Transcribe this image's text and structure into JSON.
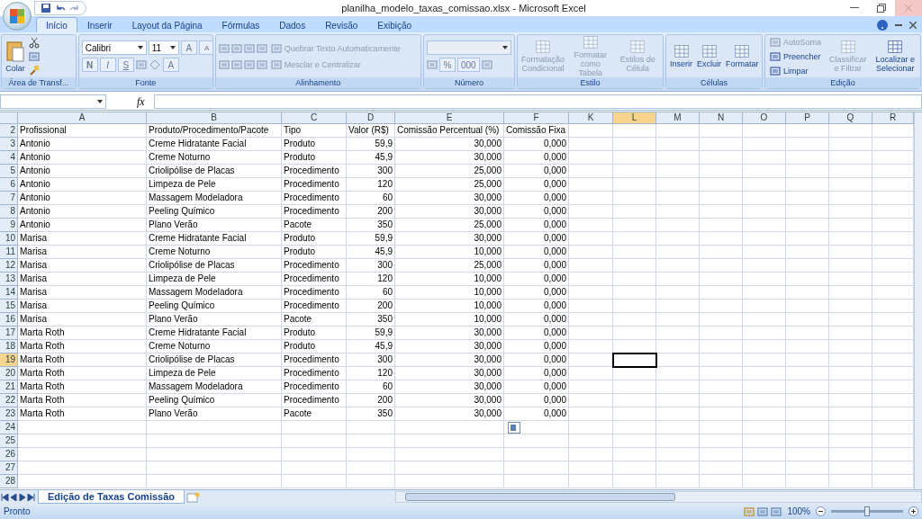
{
  "window": {
    "title": "planilha_modelo_taxas_comissao.xlsx - Microsoft Excel"
  },
  "tabs": [
    {
      "label": "Início",
      "selected": true
    },
    {
      "label": "Inserir",
      "selected": false
    },
    {
      "label": "Layout da Página",
      "selected": false
    },
    {
      "label": "Fórmulas",
      "selected": false
    },
    {
      "label": "Dados",
      "selected": false
    },
    {
      "label": "Revisão",
      "selected": false
    },
    {
      "label": "Exibição",
      "selected": false
    }
  ],
  "ribbon": {
    "clipboard": {
      "title": "Área de Transf...",
      "paste": "Colar"
    },
    "font": {
      "title": "Fonte",
      "name": "Calibri",
      "size": "11",
      "grow": "A",
      "shrink": "A",
      "bold": "N",
      "italic": "I",
      "underline": "S",
      "font_color_label": "A"
    },
    "alignment": {
      "title": "Alinhamento",
      "wrap": {
        "label": "Quebrar Texto Automaticamente",
        "disabled": true
      },
      "merge": {
        "label": "Mesclar e Centralizar",
        "disabled": true
      }
    },
    "number": {
      "title": "Número",
      "percent": "%",
      "thousands": "000"
    },
    "styles": {
      "title": "Estilo",
      "buttons": [
        {
          "label": "Formatação Condicional",
          "disabled": true
        },
        {
          "label": "Formatar como Tabela",
          "disabled": true
        },
        {
          "label": "Estilos de Célula",
          "disabled": true
        }
      ]
    },
    "cells": {
      "title": "Células",
      "buttons": [
        {
          "label": "Inserir",
          "disabled": false
        },
        {
          "label": "Excluir",
          "disabled": false
        },
        {
          "label": "Formatar",
          "disabled": false
        }
      ]
    },
    "editing": {
      "title": "Edição",
      "small": [
        {
          "label": "AutoSoma",
          "disabled": true
        },
        {
          "label": "Preencher",
          "disabled": false
        },
        {
          "label": "Limpar",
          "disabled": false
        }
      ],
      "buttons": [
        {
          "label": "Classificar e Filtrar",
          "disabled": true
        },
        {
          "label": "Localizar e Selecionar",
          "disabled": false
        }
      ]
    }
  },
  "formula_bar": {
    "function_label": "fx"
  },
  "columns": [
    {
      "label": "A",
      "kind": "text",
      "selected": false
    },
    {
      "label": "B",
      "kind": "text",
      "selected": false
    },
    {
      "label": "C",
      "kind": "text",
      "selected": false
    },
    {
      "label": "D",
      "kind": "number",
      "selected": false
    },
    {
      "label": "E",
      "kind": "number",
      "selected": false
    },
    {
      "label": "F",
      "kind": "number",
      "selected": false
    },
    {
      "label": "K",
      "kind": "text",
      "selected": false
    },
    {
      "label": "L",
      "kind": "text",
      "selected": true
    },
    {
      "label": "M",
      "kind": "text",
      "selected": false
    },
    {
      "label": "N",
      "kind": "text",
      "selected": false
    },
    {
      "label": "O",
      "kind": "text",
      "selected": false
    },
    {
      "label": "P",
      "kind": "text",
      "selected": false
    },
    {
      "label": "Q",
      "kind": "text",
      "selected": false
    },
    {
      "label": "R",
      "kind": "text",
      "selected": false
    }
  ],
  "rows": [
    {
      "number": "2",
      "selected": false,
      "cells": [
        "Profissional",
        "Produto/Procedimento/Pacote",
        "Tipo",
        "Valor (R$)",
        "Comissão Percentual (%)",
        "Comissão Fixa"
      ]
    },
    {
      "number": "3",
      "selected": false,
      "cells": [
        "Antonio",
        "Creme Hidratante Facial",
        "Produto",
        "59,9",
        "30,000",
        "0,000"
      ]
    },
    {
      "number": "4",
      "selected": false,
      "cells": [
        "Antonio",
        "Creme Noturno",
        "Produto",
        "45,9",
        "30,000",
        "0,000"
      ]
    },
    {
      "number": "5",
      "selected": false,
      "cells": [
        "Antonio",
        "Criolipólise de Placas",
        "Procedimento",
        "300",
        "25,000",
        "0,000"
      ]
    },
    {
      "number": "6",
      "selected": false,
      "cells": [
        "Antonio",
        "Limpeza de Pele",
        "Procedimento",
        "120",
        "25,000",
        "0,000"
      ]
    },
    {
      "number": "7",
      "selected": false,
      "cells": [
        "Antonio",
        "Massagem Modeladora",
        "Procedimento",
        "60",
        "30,000",
        "0,000"
      ]
    },
    {
      "number": "8",
      "selected": false,
      "cells": [
        "Antonio",
        "Peeling Químico",
        "Procedimento",
        "200",
        "30,000",
        "0,000"
      ]
    },
    {
      "number": "9",
      "selected": false,
      "cells": [
        "Antonio",
        "Plano Verão",
        "Pacote",
        "350",
        "25,000",
        "0,000"
      ]
    },
    {
      "number": "10",
      "selected": false,
      "cells": [
        "Marisa",
        "Creme Hidratante Facial",
        "Produto",
        "59,9",
        "30,000",
        "0,000"
      ]
    },
    {
      "number": "11",
      "selected": false,
      "cells": [
        "Marisa",
        "Creme Noturno",
        "Produto",
        "45,9",
        "10,000",
        "0,000"
      ]
    },
    {
      "number": "12",
      "selected": false,
      "cells": [
        "Marisa",
        "Criolipólise de Placas",
        "Procedimento",
        "300",
        "25,000",
        "0,000"
      ]
    },
    {
      "number": "13",
      "selected": false,
      "cells": [
        "Marisa",
        "Limpeza de Pele",
        "Procedimento",
        "120",
        "10,000",
        "0,000"
      ]
    },
    {
      "number": "14",
      "selected": false,
      "cells": [
        "Marisa",
        "Massagem Modeladora",
        "Procedimento",
        "60",
        "10,000",
        "0,000"
      ]
    },
    {
      "number": "15",
      "selected": false,
      "cells": [
        "Marisa",
        "Peeling Químico",
        "Procedimento",
        "200",
        "10,000",
        "0,000"
      ]
    },
    {
      "number": "16",
      "selected": false,
      "cells": [
        "Marisa",
        "Plano Verão",
        "Pacote",
        "350",
        "10,000",
        "0,000"
      ]
    },
    {
      "number": "17",
      "selected": false,
      "cells": [
        "Marta Roth",
        "Creme Hidratante Facial",
        "Produto",
        "59,9",
        "30,000",
        "0,000"
      ]
    },
    {
      "number": "18",
      "selected": false,
      "cells": [
        "Marta Roth",
        "Creme Noturno",
        "Produto",
        "45,9",
        "30,000",
        "0,000"
      ]
    },
    {
      "number": "19",
      "selected": true,
      "cells": [
        "Marta Roth",
        "Criolipólise de Placas",
        "Procedimento",
        "300",
        "30,000",
        "0,000"
      ]
    },
    {
      "number": "20",
      "selected": false,
      "cells": [
        "Marta Roth",
        "Limpeza de Pele",
        "Procedimento",
        "120",
        "30,000",
        "0,000"
      ]
    },
    {
      "number": "21",
      "selected": false,
      "cells": [
        "Marta Roth",
        "Massagem Modeladora",
        "Procedimento",
        "60",
        "30,000",
        "0,000"
      ]
    },
    {
      "number": "22",
      "selected": false,
      "cells": [
        "Marta Roth",
        "Peeling Químico",
        "Procedimento",
        "200",
        "30,000",
        "0,000"
      ]
    },
    {
      "number": "23",
      "selected": false,
      "cells": [
        "Marta Roth",
        "Plano Verão",
        "Pacote",
        "350",
        "30,000",
        "0,000"
      ]
    },
    {
      "number": "24",
      "selected": false,
      "paste_options": true,
      "cells": []
    },
    {
      "number": "25",
      "selected": false,
      "cells": []
    },
    {
      "number": "26",
      "selected": false,
      "cells": []
    },
    {
      "number": "27",
      "selected": false,
      "cells": []
    },
    {
      "number": "28",
      "selected": false,
      "cells": []
    }
  ],
  "sheets": [
    {
      "label": "Edição de Taxas Comissão",
      "selected": true
    }
  ],
  "status_bar": {
    "status": "Pronto",
    "zoom": "100%",
    "zoom_slider": {
      "level": 0.5
    }
  }
}
